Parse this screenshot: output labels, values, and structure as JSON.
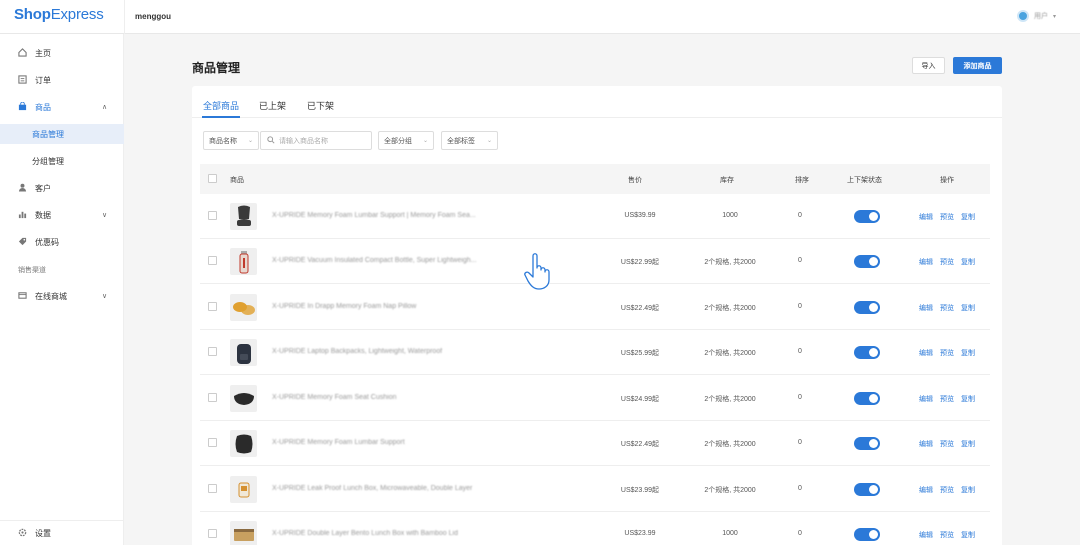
{
  "app": {
    "logo_part1": "Shop",
    "logo_part2": "Express",
    "store_name": "menggou",
    "user_name": "用户",
    "user_caret": "▾"
  },
  "sidebar": {
    "items": [
      {
        "label": "主页",
        "icon": "home-icon"
      },
      {
        "label": "订单",
        "icon": "order-icon"
      },
      {
        "label": "商品",
        "icon": "bag-icon",
        "chevron": "∧"
      },
      {
        "label": "商品管理"
      },
      {
        "label": "分组管理"
      },
      {
        "label": "客户",
        "icon": "user-icon"
      },
      {
        "label": "数据",
        "icon": "chart-icon",
        "chevron": "∨"
      },
      {
        "label": "优惠码",
        "icon": "coupon-icon"
      },
      {
        "label": "销售渠道",
        "section": true
      },
      {
        "label": "在线商城",
        "icon": "store-icon",
        "chevron": "∨"
      }
    ],
    "settings_label": "设置"
  },
  "main": {
    "title": "商品管理",
    "import_label": "导入",
    "add_label": "添加商品",
    "tabs": [
      "全部商品",
      "已上架",
      "已下架"
    ],
    "filters": {
      "field_select": "商品名称",
      "search_placeholder": "请输入商品名称",
      "group_select": "全部分组",
      "tag_select": "全部标签"
    },
    "columns": {
      "product": "商品",
      "price": "售价",
      "stock": "库存",
      "sort": "排序",
      "status": "上下架状态",
      "actions": "操作"
    },
    "action_labels": {
      "edit": "编辑",
      "preview": "预览",
      "copy": "复制"
    },
    "rows": [
      {
        "name": "X-UPRIDE Memory Foam Lumbar Support | Memory Foam Sea...",
        "price": "US$39.99",
        "stock": "1000",
        "sort": "0",
        "thumb": "seat-icon",
        "color": "#3a3a3a"
      },
      {
        "name": "X-UPRIDE Vacuum Insulated Compact Bottle, Super Lightweigh...",
        "price": "US$22.99起",
        "stock": "2个规格, 共2000",
        "sort": "0",
        "thumb": "bottle-icon",
        "color": "#c0392b"
      },
      {
        "name": "X-UPRIDE In Drapp Memory Foam Nap Pillow",
        "price": "US$22.49起",
        "stock": "2个规格, 共2000",
        "sort": "0",
        "thumb": "pillow-icon",
        "color": "#e0a030"
      },
      {
        "name": "X-UPRIDE Laptop Backpacks, Lightweight, Waterproof",
        "price": "US$25.99起",
        "stock": "2个规格, 共2000",
        "sort": "0",
        "thumb": "backpack-icon",
        "color": "#2c3340"
      },
      {
        "name": "X-UPRIDE Memory Foam Seat Cushion",
        "price": "US$24.99起",
        "stock": "2个规格, 共2000",
        "sort": "0",
        "thumb": "cushion-icon",
        "color": "#2a2a2a"
      },
      {
        "name": "X-UPRIDE Memory Foam Lumbar Support",
        "price": "US$22.49起",
        "stock": "2个规格, 共2000",
        "sort": "0",
        "thumb": "lumbar-icon",
        "color": "#2a2a2a"
      },
      {
        "name": "X-UPRIDE Leak Proof Lunch Box, Microwaveable, Double Layer",
        "price": "US$23.99起",
        "stock": "2个规格, 共2000",
        "sort": "0",
        "thumb": "lunchbox-icon",
        "color": "#d59030"
      },
      {
        "name": "X-UPRIDE Double Layer Bento Lunch Box with Bamboo Lid",
        "price": "US$23.99",
        "stock": "1000",
        "sort": "0",
        "thumb": "bento-icon",
        "color": "#c8a060"
      }
    ]
  },
  "colors": {
    "accent": "#2b79d8"
  }
}
